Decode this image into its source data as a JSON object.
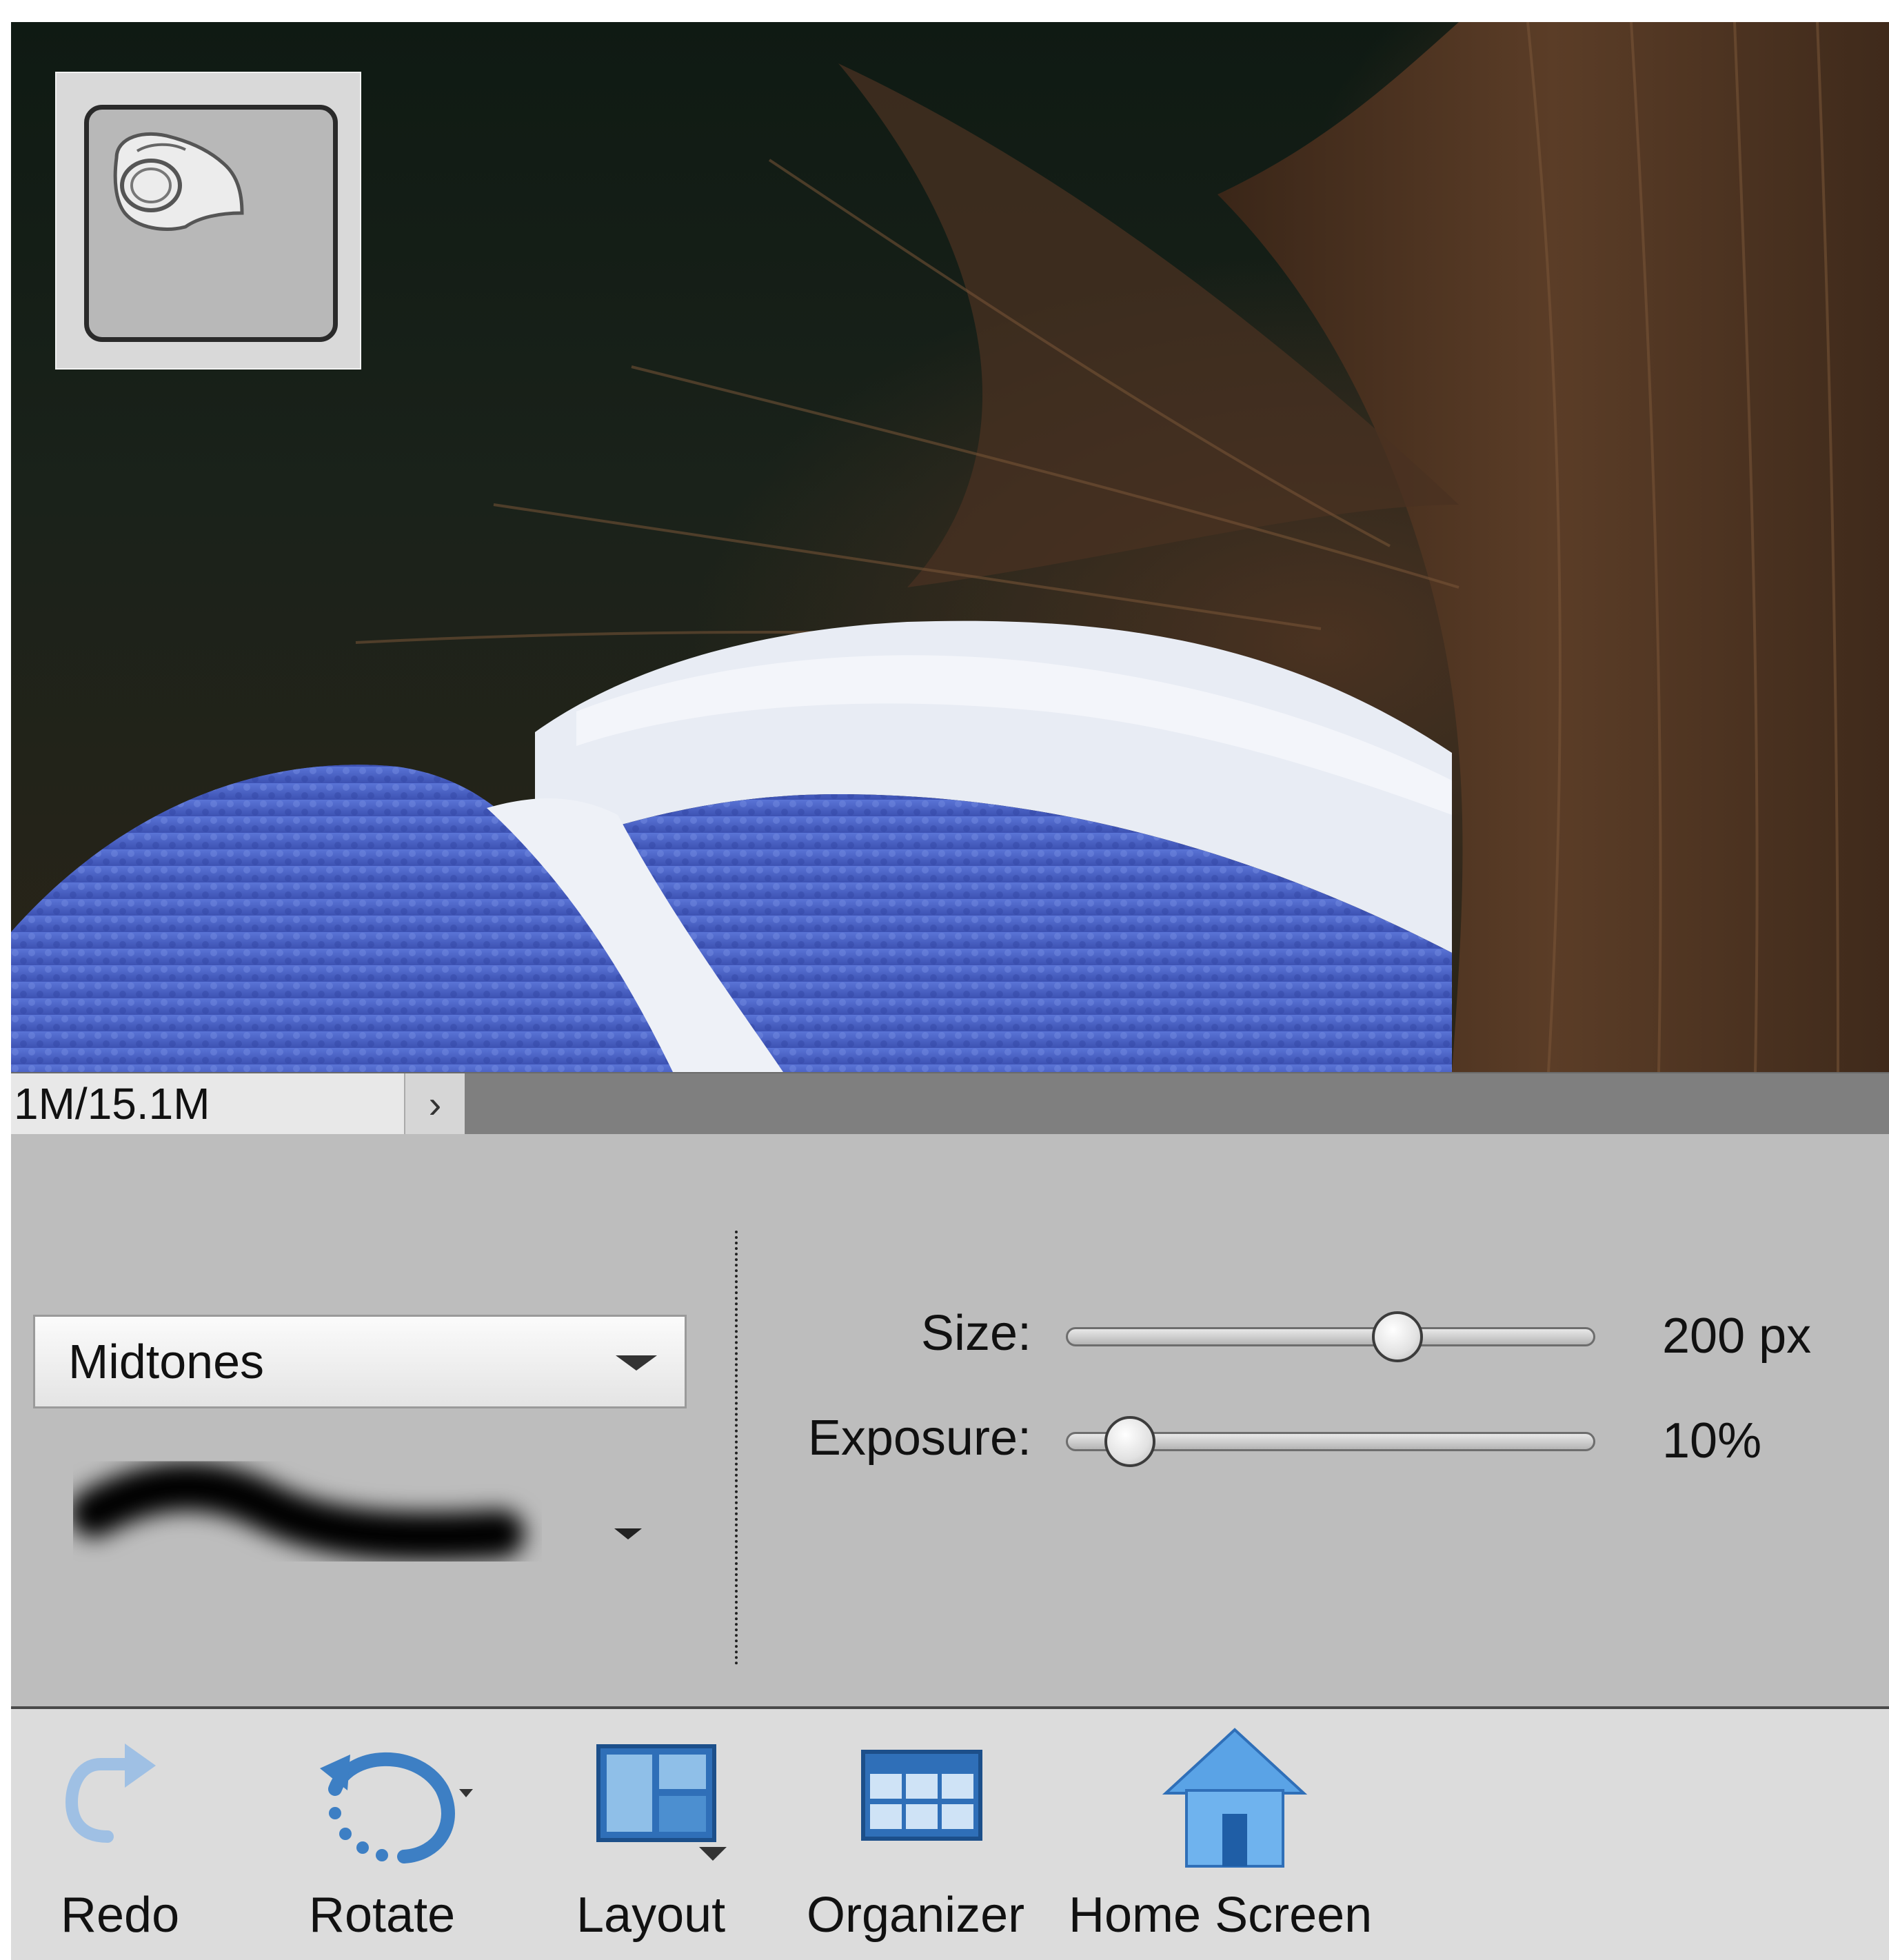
{
  "status": {
    "doc_size": "1M/15.1M",
    "more_arrow": "›"
  },
  "tool_options": {
    "range": {
      "selected": "Midtones"
    },
    "size": {
      "label": "Size:",
      "value_text": "200 px",
      "level": 0.64
    },
    "exposure": {
      "label": "Exposure:",
      "value_text": "10%",
      "level": 0.08
    }
  },
  "toolbar": {
    "items": [
      {
        "label": "Redo",
        "icon": "redo-icon"
      },
      {
        "label": "Rotate",
        "icon": "rotate-icon"
      },
      {
        "label": "Layout",
        "icon": "layout-icon"
      },
      {
        "label": "Organizer",
        "icon": "organizer-icon"
      },
      {
        "label": "Home Screen",
        "icon": "home-icon"
      }
    ]
  },
  "colors": {
    "panel": "#bdbdbd",
    "toolbar": "#dcdcdc",
    "icon_blue": "#3d7fc4",
    "sweater_blue": "#4d62c4"
  }
}
